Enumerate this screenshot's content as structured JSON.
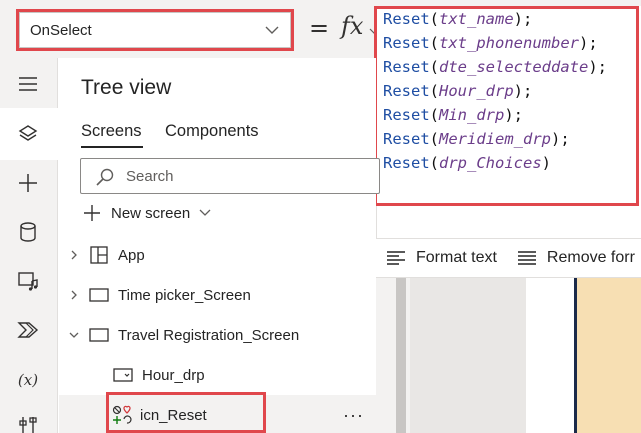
{
  "formula_bar": {
    "property": "OnSelect",
    "equals": "=",
    "fx": "fx"
  },
  "formula": {
    "lines": [
      {
        "fn": "Reset",
        "open": "(",
        "arg": "txt_name",
        "close": ");"
      },
      {
        "fn": "Reset",
        "open": "(",
        "arg": "txt_phonenumber",
        "close": ");"
      },
      {
        "fn": "Reset",
        "open": "(",
        "arg": "dte_selecteddate",
        "close": ");"
      },
      {
        "fn": "Reset",
        "open": "(",
        "arg": "Hour_drp",
        "close": ");"
      },
      {
        "fn": "Reset",
        "open": "(",
        "arg": "Min_drp",
        "close": ");"
      },
      {
        "fn": "Reset",
        "open": "(",
        "arg": "Meridiem_drp",
        "close": ");"
      },
      {
        "fn": "Reset",
        "open": "(",
        "arg": "drp_Choices",
        "close": ")"
      }
    ]
  },
  "format_bar": {
    "format_text": "Format text",
    "remove_formatting": "Remove forr"
  },
  "rail": {
    "icons": [
      "hamburger-icon",
      "layers-icon",
      "plus-icon",
      "database-icon",
      "media-icon",
      "power-automate-icon",
      "variables-icon",
      "tools-icon"
    ],
    "variables_glyph": "(x)"
  },
  "tree_view": {
    "title": "Tree view",
    "tabs": [
      "Screens",
      "Components"
    ],
    "search_placeholder": "Search",
    "new_screen": "New screen",
    "items": [
      {
        "label": "App"
      },
      {
        "label": "Time picker_Screen"
      },
      {
        "label": "Travel Registration_Screen"
      },
      {
        "label": "Hour_drp"
      },
      {
        "label": "icn_Reset"
      }
    ],
    "more": "···"
  },
  "colors": {
    "highlight": "#e0474c",
    "code_function": "#1f4ea3",
    "code_argument": "#6b3d8a"
  }
}
